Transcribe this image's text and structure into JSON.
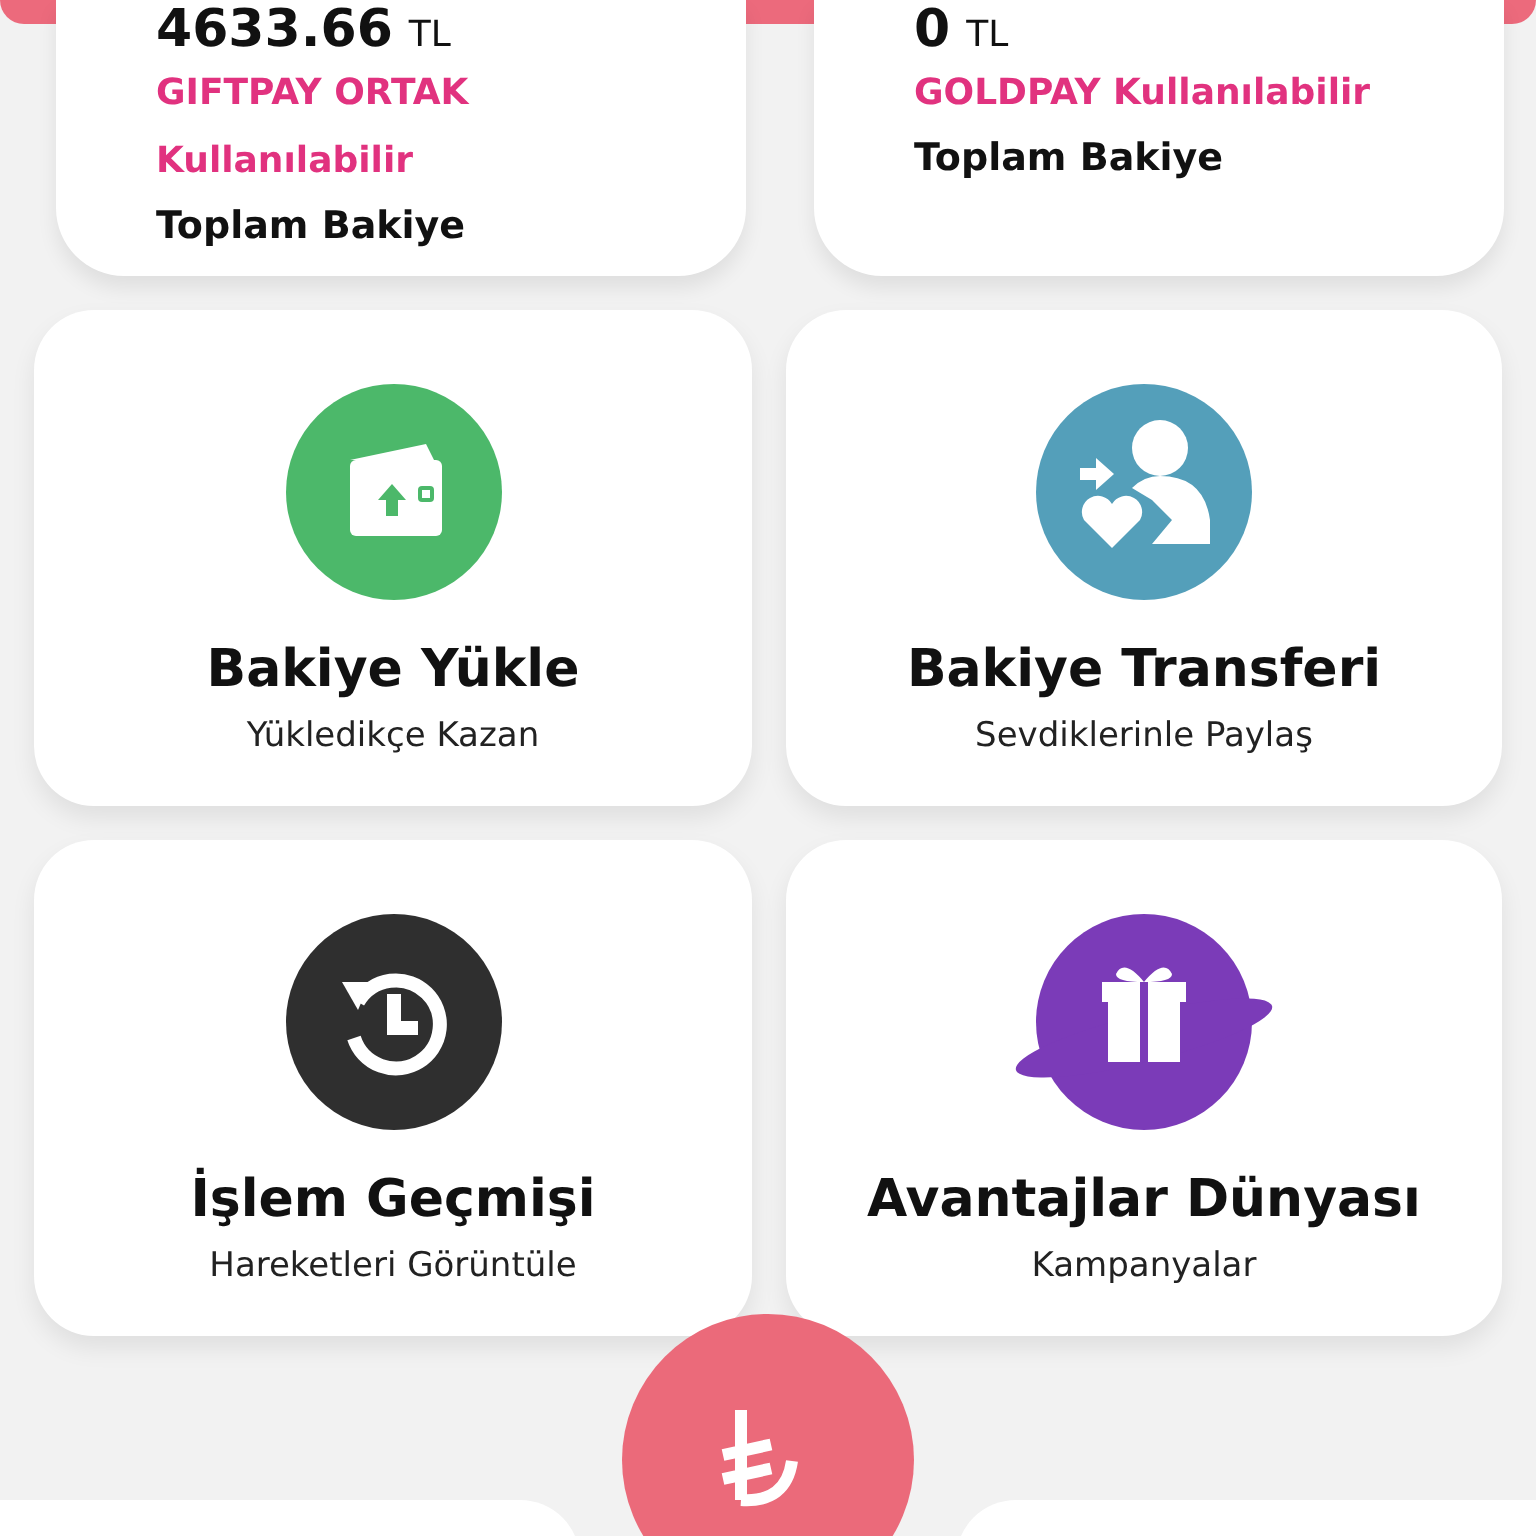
{
  "balances": [
    {
      "amount": "4633.66",
      "currency": "TL",
      "label": "GIFTPAY ORTAK Kullanılabilir",
      "caption": "Toplam Bakiye"
    },
    {
      "amount": "0",
      "currency": "TL",
      "label": "GOLDPAY Kullanılabilir",
      "caption": "Toplam Bakiye"
    }
  ],
  "actions": [
    {
      "kind": "wallet",
      "color": "#4cb86a",
      "title": "Bakiye Yükle",
      "subtitle": "Yükledikçe Kazan"
    },
    {
      "kind": "transfer",
      "color": "#549fba",
      "title": "Bakiye Transferi",
      "subtitle": "Sevdiklerinle Paylaş"
    },
    {
      "kind": "history",
      "color": "#2f2f2f",
      "title": "İşlem Geçmişi",
      "subtitle": "Hareketleri Görüntüle"
    },
    {
      "kind": "gift",
      "color": "#7b3bb8",
      "title": "Avantajlar Dünyası",
      "subtitle": "Kampanyalar"
    }
  ]
}
